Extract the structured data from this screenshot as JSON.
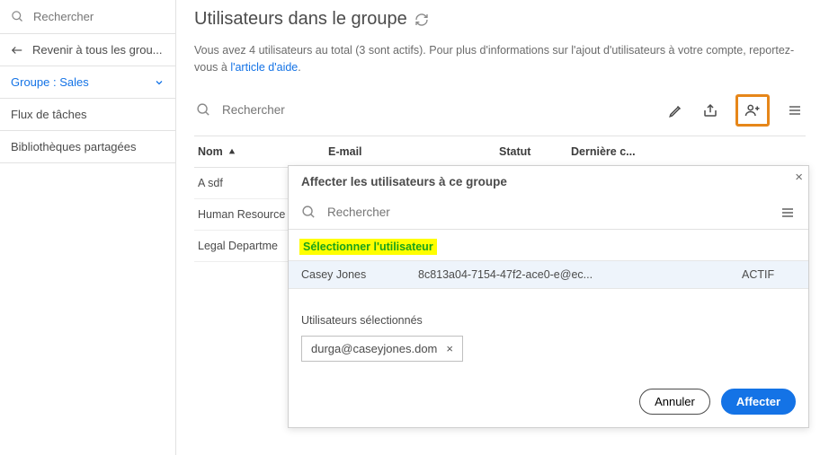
{
  "sidebar": {
    "search_placeholder": "Rechercher",
    "back_label": "Revenir à tous les grou...",
    "active_label": "Groupe : Sales",
    "items": [
      {
        "label": "Flux de tâches"
      },
      {
        "label": "Bibliothèques partagées"
      }
    ]
  },
  "page": {
    "title": "Utilisateurs dans le groupe",
    "subtitle_pre": "Vous avez 4 utilisateurs au total (3 sont actifs). Pour plus d'informations sur l'ajout d'utilisateurs à votre compte, reportez-vous à ",
    "subtitle_link": "l'article d'aide",
    "subtitle_post": "."
  },
  "table": {
    "search_placeholder": "Rechercher",
    "cols": {
      "name": "Nom",
      "email": "E-mail",
      "status": "Statut",
      "last": "Dernière c..."
    },
    "rows": [
      {
        "name": "A sdf"
      },
      {
        "name": "Human Resource"
      },
      {
        "name": "Legal Departme"
      }
    ]
  },
  "dialog": {
    "title": "Affecter les utilisateurs à ce groupe",
    "search_placeholder": "Rechercher",
    "section_label": "Sélectionner l'utilisateur",
    "user": {
      "name": "Casey Jones",
      "email": "8c813a04-7154-47f2-ace0-e@ec...",
      "status": "ACTIF"
    },
    "selected_label": "Utilisateurs sélectionnés",
    "chip": "durga@caseyjones.dom",
    "cancel": "Annuler",
    "assign": "Affecter"
  }
}
